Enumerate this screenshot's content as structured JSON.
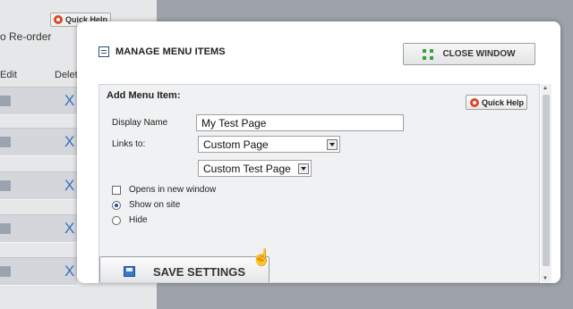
{
  "background": {
    "quick_help_label": "Quick Help",
    "reorder_text": "o Re-order",
    "col_edit": "Edit",
    "col_delete": "Delet",
    "delete_mark": "X"
  },
  "modal": {
    "title": "MANAGE MENU ITEMS",
    "close_label": "CLOSE WINDOW",
    "section_title": "Add Menu Item:",
    "quick_help_label": "Quick Help",
    "display_name_label": "Display Name",
    "display_name_value": "My Test Page",
    "links_to_label": "Links to:",
    "links_to_value": "Custom Page",
    "custom_page_value": "Custom Test Page",
    "opt_new_window": "Opens in new window",
    "opt_show": "Show on site",
    "opt_hide": "Hide",
    "selected_visibility": "Show on site",
    "save_label": "SAVE SETTINGS"
  },
  "colors": {
    "overlay": "#a8acb1",
    "accent_blue": "#3b6fc2",
    "quick_help_icon": "#d9472b",
    "close_icon": "#3aa23a"
  }
}
